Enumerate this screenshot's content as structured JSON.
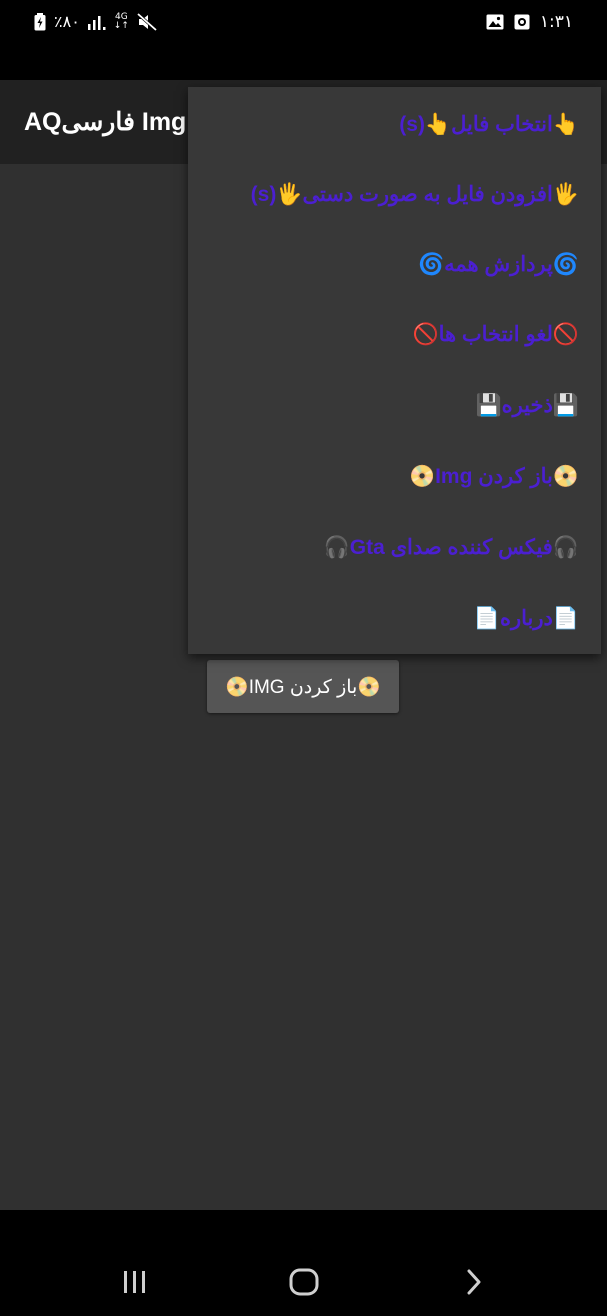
{
  "status_bar": {
    "battery_text": "٪۸۰",
    "network_label": "4G",
    "time": "۱:۳۱"
  },
  "app_bar": {
    "title": "AQفارسی Img"
  },
  "menu": {
    "items": [
      {
        "label": "👆انتخاب فایل👆(s)"
      },
      {
        "label": "🖐افزودن فایل به صورت دستی🖐(s)"
      },
      {
        "label": "🌀پردازش همه🌀"
      },
      {
        "label": "🚫لغو انتخاب ها🚫"
      },
      {
        "label": "💾ذخیره💾"
      },
      {
        "label": "📀باز کردن Img📀"
      },
      {
        "label": "🎧فیکس کننده صدای Gta🎧"
      },
      {
        "label": "📄درباره📄"
      }
    ]
  },
  "content": {
    "open_button_label": "📀باز کردن IMG📀"
  },
  "icons": {
    "status_left": [
      "battery-icon",
      "signal-icon",
      "network-4g-icon",
      "mute-icon"
    ],
    "status_right": [
      "gallery-icon",
      "record-icon"
    ],
    "nav": [
      "recent-apps-icon",
      "home-icon",
      "back-icon"
    ]
  },
  "colors": {
    "menu_text": "#4b1fd1",
    "menu_bg": "#383838",
    "app_bar_bg": "#212121",
    "content_bg": "#303030",
    "button_bg": "#555555"
  }
}
